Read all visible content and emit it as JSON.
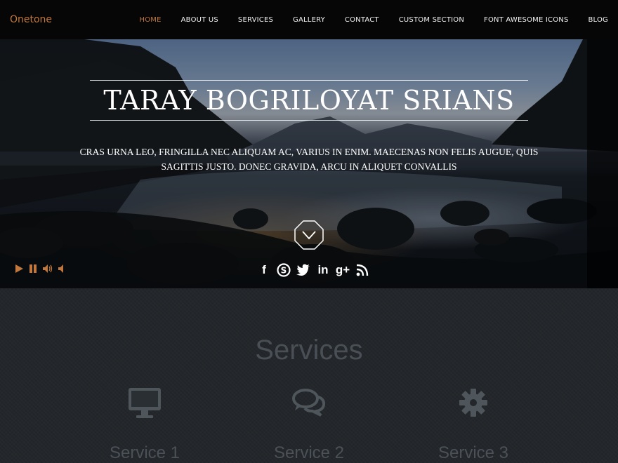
{
  "header": {
    "logo": "Onetone",
    "nav": [
      {
        "label": "HOME",
        "active": true
      },
      {
        "label": "ABOUT US"
      },
      {
        "label": "SERVICES"
      },
      {
        "label": "GALLERY"
      },
      {
        "label": "CONTACT"
      },
      {
        "label": "CUSTOM SECTION"
      },
      {
        "label": "FONT AWESOME ICONS"
      },
      {
        "label": "BLOG"
      }
    ]
  },
  "hero": {
    "title": "TARAY BOGRILOYAT SRIANS",
    "subtitle": "CRAS URNA LEO, FRINGILLA NEC ALIQUAM AC, VARIUS IN ENIM. MAECENAS NON FELIS AUGUE, QUIS SAGITTIS JUSTO. DONEC GRAVIDA, ARCU IN ALIQUET CONVALLIS",
    "social_icons": [
      "facebook-icon",
      "skype-icon",
      "twitter-icon",
      "linkedin-icon",
      "google-plus-icon",
      "rss-icon"
    ],
    "social_glyphs": [
      "f",
      "S",
      "t",
      "in",
      "g+",
      "rss"
    ],
    "media_controls": [
      "play-icon",
      "pause-icon",
      "volume-up-icon",
      "volume-down-icon"
    ]
  },
  "services": {
    "title": "Services",
    "items": [
      {
        "label": "Service 1",
        "icon": "desktop-icon"
      },
      {
        "label": "Service 2",
        "icon": "comments-icon"
      },
      {
        "label": "Service 3",
        "icon": "gear-icon"
      }
    ]
  },
  "colors": {
    "accent": "#c0783e",
    "header_bg": "#060606",
    "section_bg": "#23272b",
    "muted_text": "#494f55"
  }
}
